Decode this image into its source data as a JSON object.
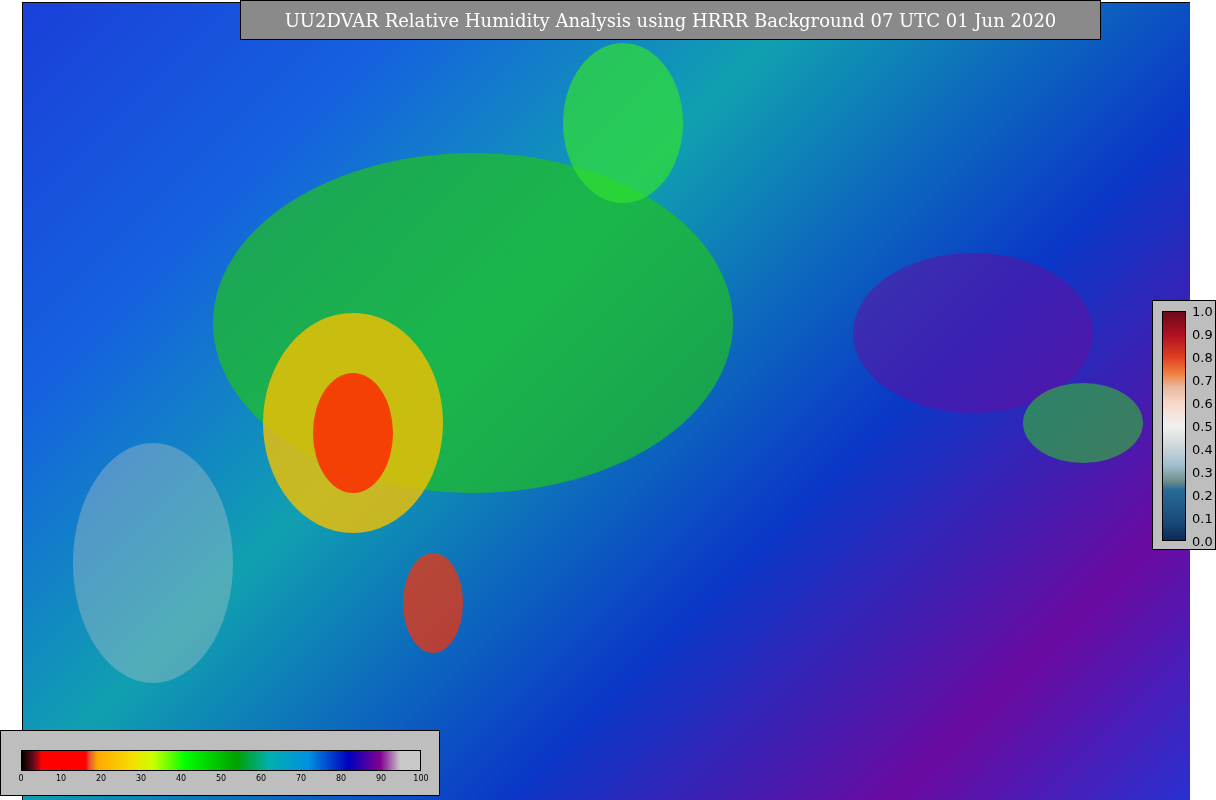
{
  "title": "UU2DVAR Relative Humidity Analysis using HRRR Background 07 UTC 01 Jun 2020",
  "humidity_colorbar": {
    "ticks": [
      "0",
      "10",
      "20",
      "30",
      "40",
      "50",
      "60",
      "70",
      "80",
      "90",
      "100"
    ]
  },
  "innovation_colorbar": {
    "ticks": [
      "1.0",
      "0.9",
      "0.8",
      "0.7",
      "0.6",
      "0.5",
      "0.4",
      "0.3",
      "0.2",
      "0.1",
      "0.0"
    ]
  }
}
